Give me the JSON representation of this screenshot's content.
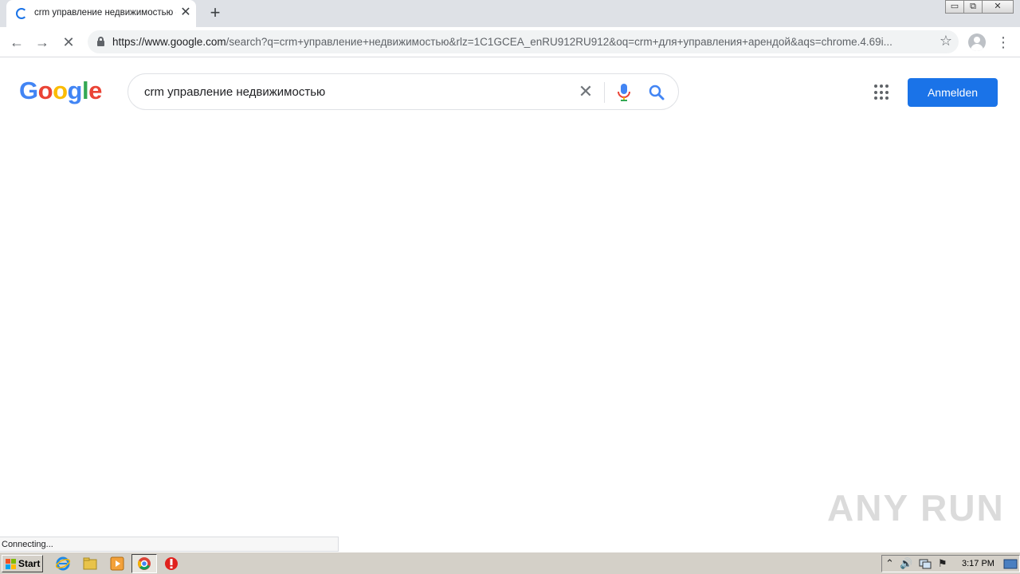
{
  "browser": {
    "tab_title": "crm управление недвижимостью -",
    "tab_close": "✕",
    "new_tab": "+",
    "window_buttons": {
      "minimize": "▭",
      "restore": "⧉",
      "close": "✕"
    },
    "url_host": "https://www.google.com",
    "url_rest": "/search?q=crm+управление+недвижимостью&rlz=1C1GCEA_enRU912RU912&oq=crm+для+управления+арендой&aqs=chrome.4.69i...",
    "nav": {
      "back": "←",
      "forward": "→",
      "stop": "✕",
      "star": "☆",
      "menu": "⋮"
    },
    "status_text": "Connecting..."
  },
  "google": {
    "logo_letters": [
      "G",
      "o",
      "o",
      "g",
      "l",
      "e"
    ],
    "logo_colors": [
      "#4285F4",
      "#EA4335",
      "#FBBC05",
      "#4285F4",
      "#34A853",
      "#EA4335"
    ],
    "search_query": "crm управление недвижимостью",
    "clear": "✕",
    "signin_label": "Anmelden",
    "accent": "#1a73e8"
  },
  "watermark": "ANY RUN",
  "taskbar": {
    "start_label": "Start",
    "clock": "3:17 PM",
    "tray_arrow": "⌃",
    "tray_volume": "🔊",
    "tray_flag": "⚑"
  }
}
